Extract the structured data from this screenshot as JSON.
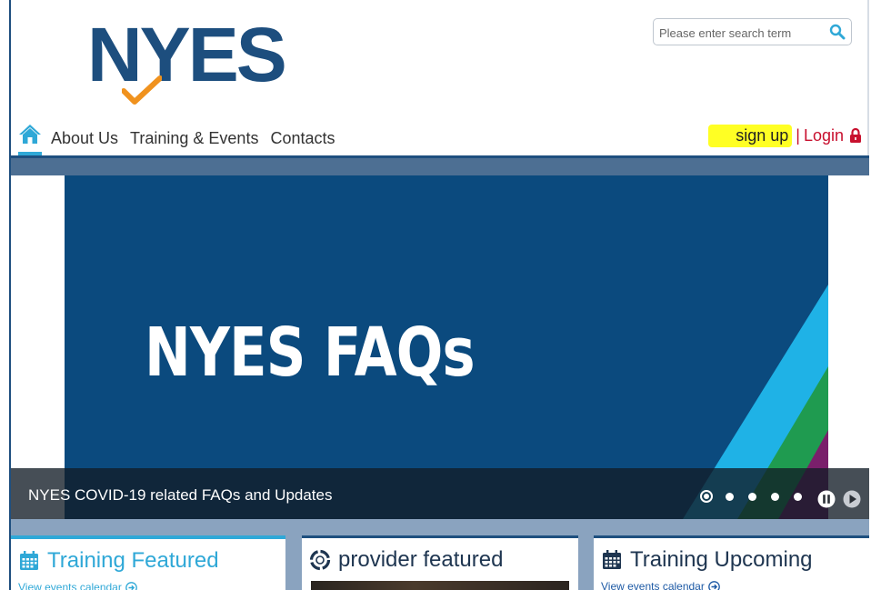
{
  "header": {
    "logo_text": "NYES",
    "search": {
      "placeholder": "Please enter search term"
    }
  },
  "nav": {
    "items": [
      {
        "label": "About Us"
      },
      {
        "label": "Training & Events"
      },
      {
        "label": "Contacts"
      }
    ]
  },
  "auth": {
    "signup_label": "sign up",
    "separator": "|",
    "login_label": "Login"
  },
  "slider": {
    "slide_title": "NYES FAQs",
    "caption": "NYES COVID-19 related FAQs and Updates",
    "slide_count": 5,
    "active_slide": 1
  },
  "cards": [
    {
      "title": "Training Featured",
      "link": "View events calendar"
    },
    {
      "title": "provider featured",
      "link": ""
    },
    {
      "title": "Training Upcoming",
      "link": "View events calendar"
    }
  ],
  "colors": {
    "brand_navy": "#1d4e7e",
    "accent_cyan": "#2fa8d7",
    "login_red": "#c8102e",
    "highlight_yellow": "#ffff24",
    "check_orange": "#f0921e"
  },
  "icons": {
    "search": "search-icon",
    "home": "home-icon",
    "lock": "lock-icon",
    "calendar": "calendar-icon",
    "provider": "refresh-circle-icon",
    "pause": "pause-icon",
    "play": "play-icon",
    "arrow": "arrow-right-circle-icon"
  }
}
